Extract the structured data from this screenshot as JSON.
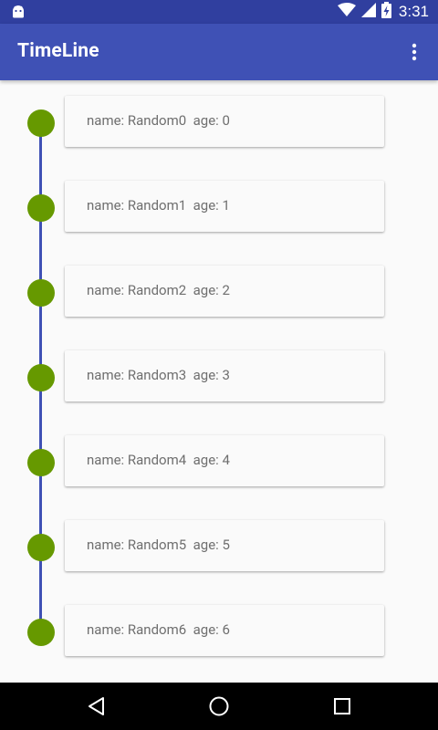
{
  "status_bar": {
    "time": "3:31",
    "icons": [
      "android-icon",
      "wifi-icon",
      "signal-icon",
      "battery-charging-icon"
    ]
  },
  "app_bar": {
    "title": "TimeLine",
    "menu_icon": "more-vert-icon"
  },
  "timeline": {
    "line_color": "#3f51b5",
    "dot_color": "#669900",
    "items": [
      {
        "text": "name: Random0  age: 0"
      },
      {
        "text": "name: Random1  age: 1"
      },
      {
        "text": "name: Random2  age: 2"
      },
      {
        "text": "name: Random3  age: 3"
      },
      {
        "text": "name: Random4  age: 4"
      },
      {
        "text": "name: Random5  age: 5"
      },
      {
        "text": "name: Random6  age: 6"
      }
    ]
  },
  "nav_bar": {
    "icons": [
      "back-icon",
      "home-icon",
      "recents-icon"
    ]
  }
}
